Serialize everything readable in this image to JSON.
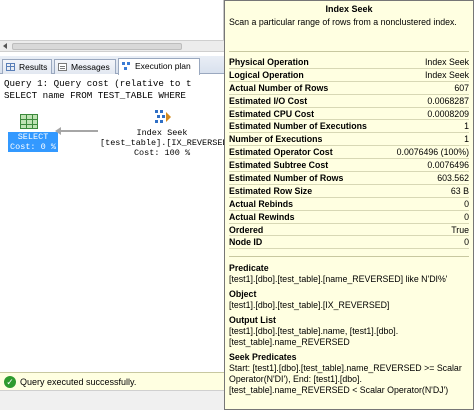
{
  "results_tabs": [
    {
      "label": "Results"
    },
    {
      "label": "Messages"
    },
    {
      "label": "Execution plan"
    }
  ],
  "query_lines": [
    "Query 1: Query cost (relative to t",
    "SELECT name FROM TEST_TABLE WHERE"
  ],
  "plan": {
    "select_node": {
      "line1": "SELECT",
      "line2": "Cost: 0 %"
    },
    "seek_node": {
      "line1": "Index Seek",
      "line2": "[test_table].[IX_REVERSED]",
      "line3": "Cost: 100 %"
    }
  },
  "status": {
    "text": "Query executed successfully.",
    "icon": "check-icon",
    "color": "#2e9b2e"
  },
  "tooltip": {
    "title": "Index Seek",
    "description": "Scan a particular range of rows from a nonclustered index.",
    "properties": [
      {
        "name": "Physical Operation",
        "value": "Index Seek"
      },
      {
        "name": "Logical Operation",
        "value": "Index Seek"
      },
      {
        "name": "Actual Number of Rows",
        "value": "607"
      },
      {
        "name": "Estimated I/O Cost",
        "value": "0.0068287"
      },
      {
        "name": "Estimated CPU Cost",
        "value": "0.0008209"
      },
      {
        "name": "Estimated Number of Executions",
        "value": "1"
      },
      {
        "name": "Number of Executions",
        "value": "1"
      },
      {
        "name": "Estimated Operator Cost",
        "value": "0.0076496 (100%)"
      },
      {
        "name": "Estimated Subtree Cost",
        "value": "0.0076496"
      },
      {
        "name": "Estimated Number of Rows",
        "value": "603.562"
      },
      {
        "name": "Estimated Row Size",
        "value": "63 B"
      },
      {
        "name": "Actual Rebinds",
        "value": "0"
      },
      {
        "name": "Actual Rewinds",
        "value": "0"
      },
      {
        "name": "Ordered",
        "value": "True"
      },
      {
        "name": "Node ID",
        "value": "0"
      }
    ],
    "predicate": {
      "heading": "Predicate",
      "text": "[test1].[dbo].[test_table].[name_REVERSED] like N'DI%'"
    },
    "object": {
      "heading": "Object",
      "text": "[test1].[dbo].[test_table].[IX_REVERSED]"
    },
    "output_list": {
      "heading": "Output List",
      "text": "[test1].[dbo].[test_table].name, [test1].[dbo].[test_table].name_REVERSED"
    },
    "seek_predicates": {
      "heading": "Seek Predicates",
      "text": "Start: [test1].[dbo].[test_table].name_REVERSED >= Scalar Operator(N'DI'), End: [test1].[dbo].[test_table].name_REVERSED < Scalar Operator(N'DJ')"
    }
  },
  "colors": {
    "tooltip_bg": "#ffffe1",
    "selected_node": "#3399ff"
  }
}
